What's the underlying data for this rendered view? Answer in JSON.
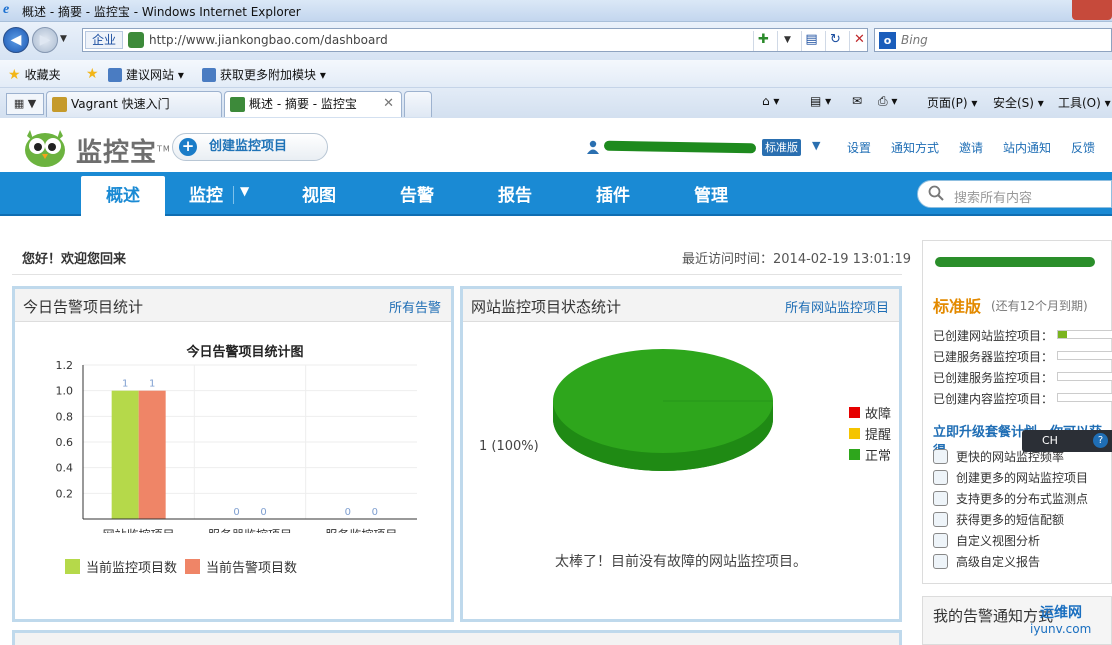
{
  "browser": {
    "window_title": "概述 - 摘要 - 监控宝 - Windows Internet Explorer",
    "zone": "企业",
    "url": "http://www.jiankongbao.com/dashboard",
    "search_placeholder": "Bing",
    "favorites_label": "收藏夹",
    "fav_items": [
      "建议网站 ▾",
      "获取更多附加模块 ▾"
    ],
    "tabs": [
      {
        "label": "Vagrant 快速入门",
        "active": false
      },
      {
        "label": "概述 - 摘要 - 监控宝",
        "active": true
      }
    ],
    "commands": [
      "页面(P) ▾",
      "安全(S) ▾",
      "工具(O) ▾"
    ]
  },
  "site": {
    "brand": "监控宝",
    "create_button": "创建监控项目",
    "edition_badge": "标准版",
    "top_links": [
      "设置",
      "通知方式",
      "邀请",
      "站内通知",
      "反馈"
    ],
    "nav": [
      {
        "label": "概述",
        "active": true
      },
      {
        "label": "监控",
        "active": false
      },
      {
        "label": "视图",
        "active": false
      },
      {
        "label": "告警",
        "active": false
      },
      {
        "label": "报告",
        "active": false
      },
      {
        "label": "插件",
        "active": false
      },
      {
        "label": "管理",
        "active": false
      }
    ],
    "search_placeholder": "搜索所有内容"
  },
  "main": {
    "welcome": "您好！欢迎您回来",
    "last_visit": "最近访问时间：2014-02-19 13:01:19",
    "alerts_panel": {
      "title": "今日告警项目统计",
      "link": "所有告警",
      "legend_monitor": "当前监控项目数",
      "legend_alert": "当前告警项目数"
    },
    "status_panel": {
      "title": "网站监控项目状态统计",
      "link": "所有网站监控项目",
      "slice_label": "1 (100%)",
      "legend": [
        {
          "label": "故障",
          "color": "#e60000"
        },
        {
          "label": "提醒",
          "color": "#f5c400"
        },
        {
          "label": "正常",
          "color": "#2ea61c"
        }
      ],
      "message": "太棒了！目前没有故障的网站监控项目。"
    }
  },
  "sidebar": {
    "edition": "标准版",
    "remaining": "(还有12个月到期)",
    "quotas": [
      {
        "label": "已创建网站监控项目：",
        "fraction": 0.15
      },
      {
        "label": "已建服务器监控项目：",
        "fraction": 0
      },
      {
        "label": "已创建服务监控项目：",
        "fraction": 0
      },
      {
        "label": "已创建内容监控项目：",
        "fraction": 0
      }
    ],
    "upgrade": "立即升级套餐计划，你可以获得",
    "features": [
      "更快的网站监控频率",
      "创建更多的网站监控项目",
      "支持更多的分布式监测点",
      "获得更多的短信配额",
      "自定义视图分析",
      "高级自定义报告"
    ],
    "ime": "CH",
    "notify_title": "我的告警通知方式",
    "watermark1": "运维网",
    "watermark2": "iyunv.com"
  },
  "chart_data": [
    {
      "type": "bar",
      "title": "今日告警项目统计图",
      "categories": [
        "网站监控项目",
        "服务器监控项目",
        "服务监控项目"
      ],
      "series": [
        {
          "name": "当前监控项目数",
          "values": [
            1,
            0,
            0
          ],
          "color": "#b5d94a"
        },
        {
          "name": "当前告警项目数",
          "values": [
            1,
            0,
            0
          ],
          "color": "#ef8567"
        }
      ],
      "ylim": [
        0,
        1.2
      ],
      "yticks": [
        0.2,
        0.4,
        0.6,
        0.8,
        1.0,
        1.2
      ],
      "grid": true,
      "legend": "bottom"
    },
    {
      "type": "pie",
      "slices": [
        {
          "name": "正常",
          "value": 1,
          "percent": 100,
          "color": "#2ea61c"
        }
      ],
      "legend": "right"
    }
  ]
}
